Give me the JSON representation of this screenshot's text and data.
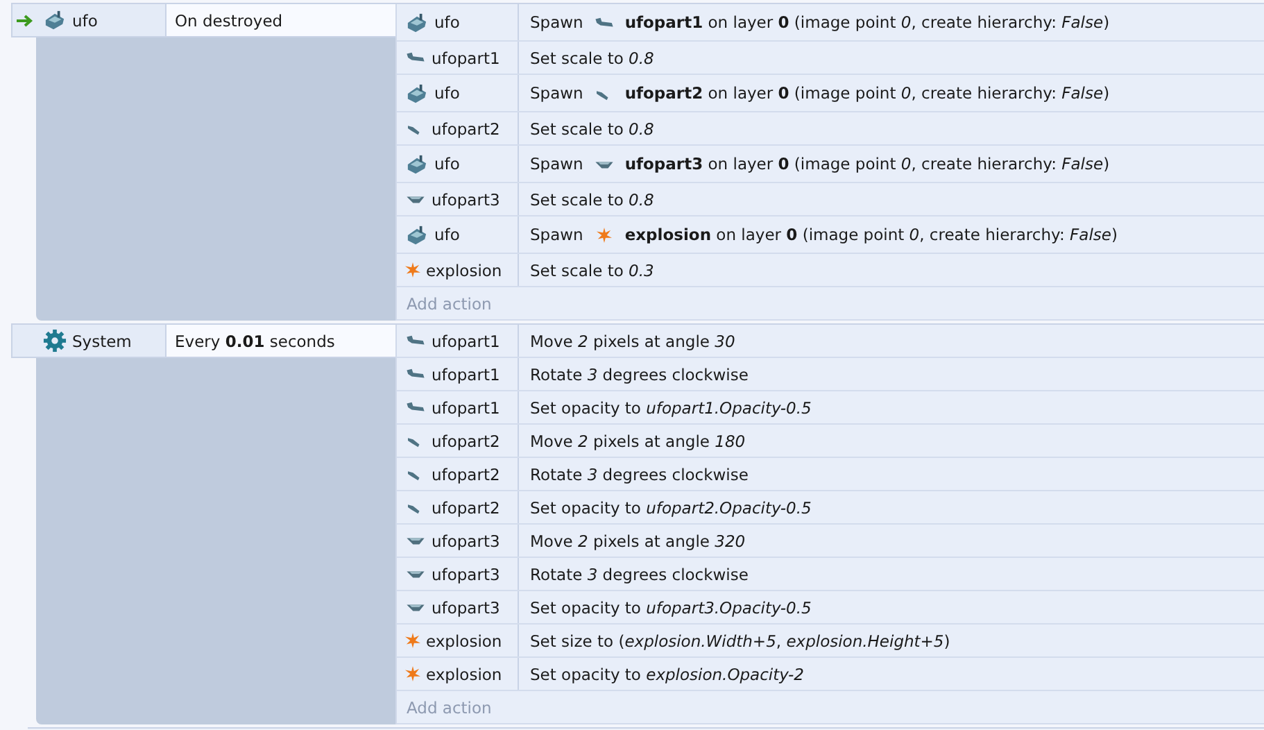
{
  "events": [
    {
      "trigger": true,
      "condition": {
        "object": "ufo",
        "text": "On destroyed"
      },
      "actions": [
        {
          "kind": "spawn",
          "object": "ufo",
          "prefix": "Spawn",
          "text": "**ufopart1** on layer **0** (image point *0*, create hierarchy: *False*)"
        },
        {
          "kind": "plain",
          "object": "ufopart1",
          "text": "Set scale to *0.8*"
        },
        {
          "kind": "spawn",
          "object": "ufo",
          "prefix": "Spawn",
          "text": "**ufopart2** on layer **0** (image point *0*, create hierarchy: *False*)"
        },
        {
          "kind": "plain",
          "object": "ufopart2",
          "text": "Set scale to *0.8*"
        },
        {
          "kind": "spawn",
          "object": "ufo",
          "prefix": "Spawn",
          "text": "**ufopart3** on layer **0** (image point *0*, create hierarchy: *False*)"
        },
        {
          "kind": "plain",
          "object": "ufopart3",
          "text": "Set scale to *0.8*"
        },
        {
          "kind": "spawn",
          "object": "ufo",
          "prefix": "Spawn",
          "text": "**explosion** on layer **0** (image point *0*, create hierarchy: *False*)"
        },
        {
          "kind": "plain",
          "object": "explosion",
          "text": "Set scale to *0.3*"
        }
      ],
      "add_action": "Add action"
    },
    {
      "trigger": false,
      "condition": {
        "object": "System",
        "text": "Every **0.01** seconds"
      },
      "actions": [
        {
          "kind": "plain",
          "object": "ufopart1",
          "text": "Move *2* pixels at angle *30*"
        },
        {
          "kind": "plain",
          "object": "ufopart1",
          "text": "Rotate *3* degrees clockwise"
        },
        {
          "kind": "plain",
          "object": "ufopart1",
          "text": "Set opacity to *ufopart1.Opacity-0.5*"
        },
        {
          "kind": "plain",
          "object": "ufopart2",
          "text": "Move *2* pixels at angle *180*"
        },
        {
          "kind": "plain",
          "object": "ufopart2",
          "text": "Rotate *3* degrees clockwise"
        },
        {
          "kind": "plain",
          "object": "ufopart2",
          "text": "Set opacity to *ufopart2.Opacity-0.5*"
        },
        {
          "kind": "plain",
          "object": "ufopart3",
          "text": "Move *2* pixels at angle *320*"
        },
        {
          "kind": "plain",
          "object": "ufopart3",
          "text": "Rotate *3* degrees clockwise"
        },
        {
          "kind": "plain",
          "object": "ufopart3",
          "text": "Set opacity to *ufopart3.Opacity-0.5*"
        },
        {
          "kind": "plain",
          "object": "explosion",
          "text": "Set size to (*explosion.Width+5*, *explosion.Height+5*)"
        },
        {
          "kind": "plain",
          "object": "explosion",
          "text": "Set opacity to *explosion.Opacity-2*"
        }
      ],
      "add_action": "Add action"
    }
  ]
}
